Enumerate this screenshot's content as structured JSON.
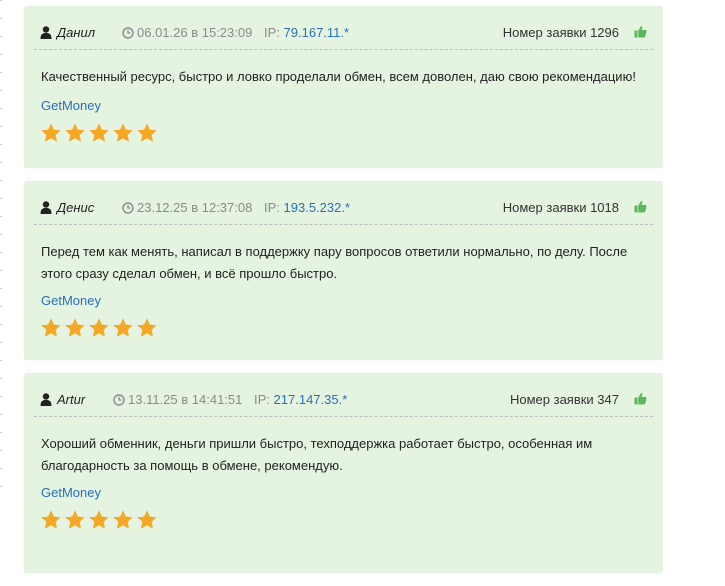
{
  "colors": {
    "card_bg": "#e5f4e0",
    "link": "#2a6fb8",
    "star": "#f5a623",
    "thumb": "#5cb85c",
    "muted": "#8a8a8a"
  },
  "reviews": [
    {
      "author": "Данил",
      "date": "06.01.26 в 15:23:09",
      "ip_label": "IP:",
      "ip": "79.167.11.*",
      "order": "Номер заявки 1296",
      "text": "Качественный ресурс, быстро и ловко проделали обмен, всем доволен, даю свою рекомендацию!",
      "service": "GetMoney",
      "rating": 5
    },
    {
      "author": "Денис",
      "date": "23.12.25 в 12:37:08",
      "ip_label": "IP:",
      "ip": "193.5.232.*",
      "order": "Номер заявки 1018",
      "text": "Перед тем как менять, написал в поддержку пару вопросов ответили нормально, по делу. После этого сразу сделал обмен, и всё прошло быстро.",
      "service": "GetMoney",
      "rating": 5
    },
    {
      "author": "Artur",
      "date": "13.11.25 в 14:41:51",
      "ip_label": "IP:",
      "ip": "217.147.35.*",
      "order": "Номер заявки 347",
      "text": "Хороший обменник, деньги пришли быстро, техподдержка работает быстро, особенная им благодарность за помощь в обмене, рекомендую.",
      "service": "GetMoney",
      "rating": 5
    }
  ]
}
